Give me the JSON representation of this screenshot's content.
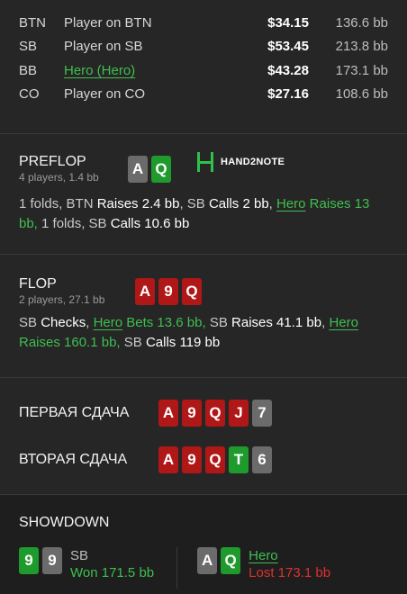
{
  "players": [
    {
      "pos": "BTN",
      "name": "Player on BTN",
      "stack": "$34.15",
      "bb": "136.6 bb",
      "hero": false
    },
    {
      "pos": "SB",
      "name": "Player on SB",
      "stack": "$53.45",
      "bb": "213.8 bb",
      "hero": false
    },
    {
      "pos": "BB",
      "name": "Hero (Hero)",
      "stack": "$43.28",
      "bb": "173.1 bb",
      "hero": true
    },
    {
      "pos": "CO",
      "name": "Player on CO",
      "stack": "$27.16",
      "bb": "108.6 bb",
      "hero": false
    }
  ],
  "preflop": {
    "title": "PREFLOP",
    "sub": "4 players, 1.4 bb",
    "cards": [
      "A",
      "Q"
    ],
    "logo": "HAND2NOTE",
    "actions": {
      "a1": "1 folds, BTN ",
      "a2": "Raises 2.4 bb",
      "a3": ", SB ",
      "a4": "Calls 2 bb",
      "a5": ", ",
      "hero": "Hero",
      "a6": " Raises 13 bb,",
      "a7": " 1 folds, SB ",
      "a8": "Calls 10.6 bb"
    }
  },
  "flop": {
    "title": "FLOP",
    "sub": "2 players, 27.1 bb",
    "cards": [
      "A",
      "9",
      "Q"
    ],
    "actions": {
      "a1": "SB ",
      "a2": "Checks",
      "a3": ", ",
      "hero1": "Hero",
      "a4": " Bets 13.6 bb,",
      "a5": " SB ",
      "a6": "Raises 41.1 bb",
      "a7": ", ",
      "hero2": "Hero",
      "a8": " Raises 160.1 bb,",
      "a9": " SB ",
      "a10": "Calls 119 bb"
    }
  },
  "runs": [
    {
      "label": "ПЕРВАЯ СДАЧА",
      "cards": [
        {
          "r": "A",
          "c": "red"
        },
        {
          "r": "9",
          "c": "red"
        },
        {
          "r": "Q",
          "c": "red"
        },
        {
          "r": "J",
          "c": "red"
        },
        {
          "r": "7",
          "c": "grey"
        }
      ]
    },
    {
      "label": "ВТОРАЯ СДАЧА",
      "cards": [
        {
          "r": "A",
          "c": "red"
        },
        {
          "r": "9",
          "c": "red"
        },
        {
          "r": "Q",
          "c": "red"
        },
        {
          "r": "T",
          "c": "green"
        },
        {
          "r": "6",
          "c": "grey"
        }
      ]
    }
  ],
  "showdown": {
    "title": "SHOWDOWN",
    "left": {
      "name": "SB",
      "result": "Won 171.5 bb",
      "cards": [
        {
          "r": "9",
          "c": "green"
        },
        {
          "r": "9",
          "c": "grey"
        }
      ]
    },
    "right": {
      "name": "Hero",
      "result": "Lost 173.1 bb",
      "cards": [
        {
          "r": "A",
          "c": "grey"
        },
        {
          "r": "Q",
          "c": "green"
        }
      ]
    }
  },
  "colors": {
    "red_card": "#b01717",
    "grey_card": "#6b6b6b",
    "green_card": "#1f9a2c",
    "hero_green": "#3fbf4f",
    "lost_red": "#e03030"
  }
}
